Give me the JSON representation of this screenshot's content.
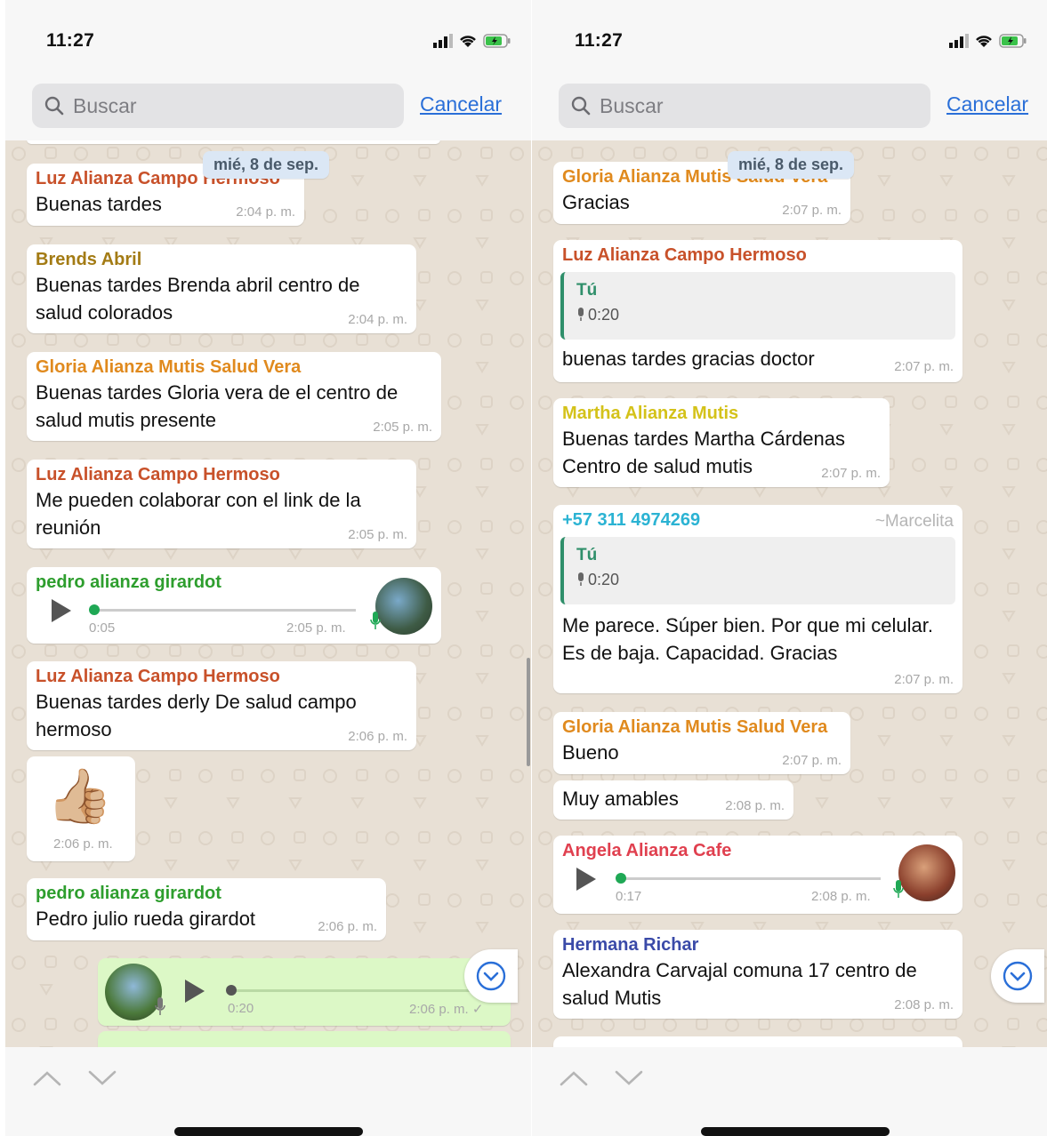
{
  "status": {
    "time": "11:27"
  },
  "search": {
    "placeholder": "Buscar",
    "cancel_label": "Cancelar"
  },
  "colors": {
    "chat_bg": "#e8e0d5",
    "outgoing": "#dcf8c6",
    "link": "#2a6fd8",
    "scroll_arrow": "#2a6fd8"
  },
  "icons": [
    "search-icon",
    "signal-icon",
    "wifi-icon",
    "battery-icon",
    "play-icon",
    "microphone-icon",
    "chevron-down-circle-icon",
    "chevron-up-icon",
    "chevron-down-icon",
    "checkmark-icon"
  ],
  "left": {
    "date_chip": "mié, 8 de sep.",
    "messages": [
      {
        "sender": "Luz Alianza Campo Hermoso",
        "sender_color": "#c8512a",
        "text": "Buenas tardes",
        "time": "2:04 p. m."
      },
      {
        "sender": "Brends Abril",
        "sender_color": "#a37b14",
        "text": "Buenas tardes Brenda abril centro de salud colorados",
        "time": "2:04 p. m."
      },
      {
        "sender": "Gloria Alianza Mutis Salud Vera",
        "sender_color": "#e08a1e",
        "text": "Buenas tardes Gloria vera de el centro de salud mutis presente",
        "time": "2:05 p. m."
      },
      {
        "sender": "Luz Alianza Campo Hermoso",
        "sender_color": "#c8512a",
        "text": "Me pueden colaborar con el link de la reunión",
        "time": "2:05 p. m."
      },
      {
        "sender": "pedro alianza girardot",
        "sender_color": "#2e9e2e",
        "duration": "0:05",
        "time": "2:05 p. m."
      },
      {
        "sender": "Luz Alianza Campo Hermoso",
        "sender_color": "#c8512a",
        "text": "Buenas tardes derly  De salud campo hermoso",
        "time": "2:06 p. m."
      },
      {
        "emoji": "👍🏼",
        "time": "2:06 p. m."
      },
      {
        "sender": "pedro alianza girardot",
        "sender_color": "#2e9e2e",
        "text": "Pedro julio rueda girardot",
        "time": "2:06 p. m."
      },
      {
        "duration": "0:20",
        "time": "2:06 p. m. ✓"
      }
    ]
  },
  "right": {
    "date_chip": "mié, 8 de sep.",
    "messages": [
      {
        "sender": "Gloria Alianza Mutis Salud Vera",
        "sender_color": "#e08a1e",
        "text": "Gracias",
        "time": "2:07 p. m."
      },
      {
        "sender": "Luz Alianza Campo Hermoso",
        "sender_color": "#c8512a",
        "quote_author": "Tú",
        "quote_duration": "0:20",
        "text": "buenas tardes gracias doctor",
        "time": "2:07 p. m."
      },
      {
        "sender": "Martha Alianza Mutis",
        "sender_color": "#d4c21a",
        "text": "Buenas tardes Martha Cárdenas Centro de salud mutis",
        "time": "2:07 p. m."
      },
      {
        "sender": "+57 311 4974269",
        "sender_color": "#2bb3d3",
        "alias": "~Marcelita",
        "quote_author": "Tú",
        "quote_duration": "0:20",
        "text": "Me parece. Súper bien. Por que  mi celular. Es de baja. Capacidad.  Gracias",
        "time": "2:07 p. m."
      },
      {
        "sender": "Gloria Alianza Mutis Salud Vera",
        "sender_color": "#e08a1e",
        "text": "Bueno",
        "time": "2:07 p. m."
      },
      {
        "text": "Muy amables",
        "time": "2:08 p. m."
      },
      {
        "sender": "Angela Alianza Cafe",
        "sender_color": "#e0404f",
        "duration": "0:17",
        "time": "2:08 p. m."
      },
      {
        "sender": "Hermana Richar",
        "sender_color": "#3a4aa8",
        "text": "Alexandra Carvajal comuna 17 centro de salud Mutis",
        "time": "2:08 p. m."
      }
    ]
  }
}
